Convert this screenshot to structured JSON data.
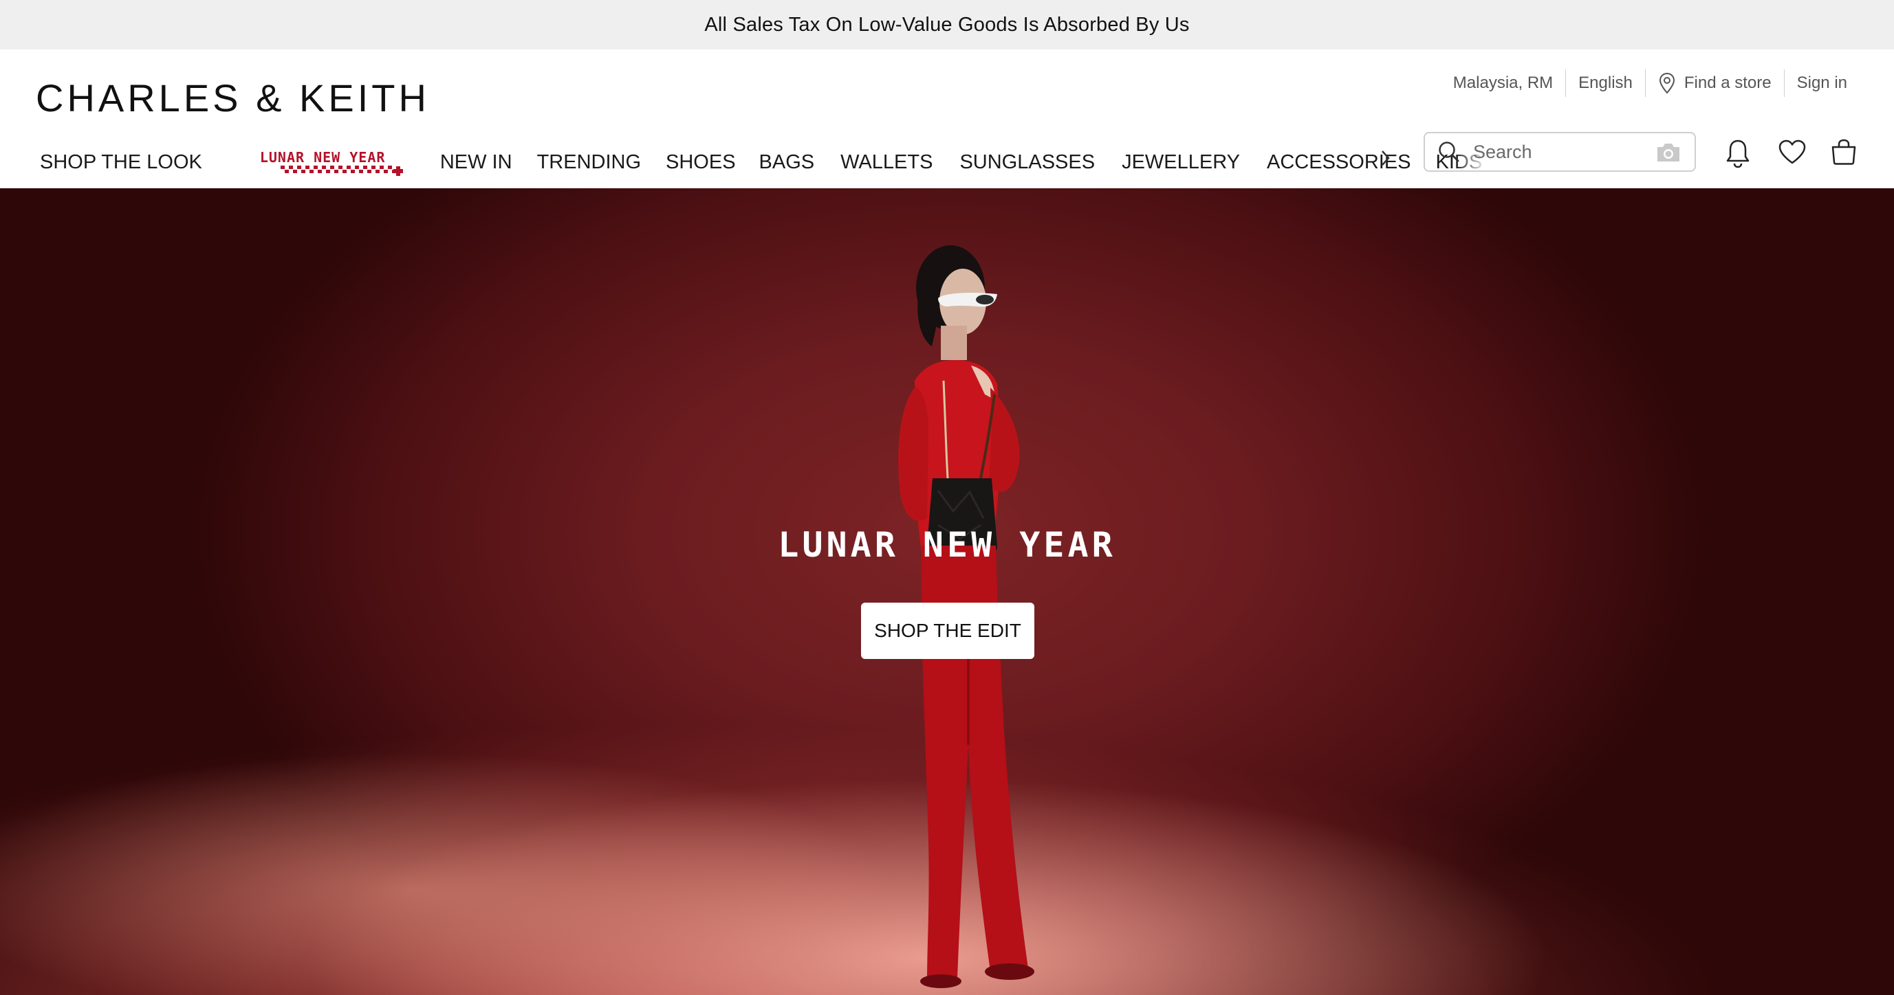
{
  "announcement": {
    "text": "All Sales Tax On Low-Value Goods Is Absorbed By Us"
  },
  "header": {
    "logo": "CHARLES & KEITH",
    "utility": {
      "region": "Malaysia, RM",
      "language": "English",
      "find_store": "Find a store",
      "sign_in": "Sign in"
    },
    "nav": {
      "shop_the_look": "SHOP THE LOOK",
      "lunar_new_year": "LUNAR NEW YEAR",
      "items": [
        "NEW IN",
        "TRENDING",
        "SHOES",
        "BAGS",
        "WALLETS",
        "SUNGLASSES",
        "JEWELLERY",
        "ACCESSORIES",
        "KIDS"
      ]
    },
    "search": {
      "placeholder": "Search"
    },
    "icons": [
      "search-icon",
      "camera-icon",
      "bell-icon",
      "heart-icon",
      "bag-icon",
      "chevron-right-icon",
      "location-pin-icon"
    ]
  },
  "hero": {
    "title": "LUNAR NEW YEAR",
    "cta": "SHOP THE EDIT"
  },
  "colors": {
    "brand_red": "#b3132a",
    "hero_bg": "#6b1c1f",
    "announcement_bg": "#efefef"
  }
}
